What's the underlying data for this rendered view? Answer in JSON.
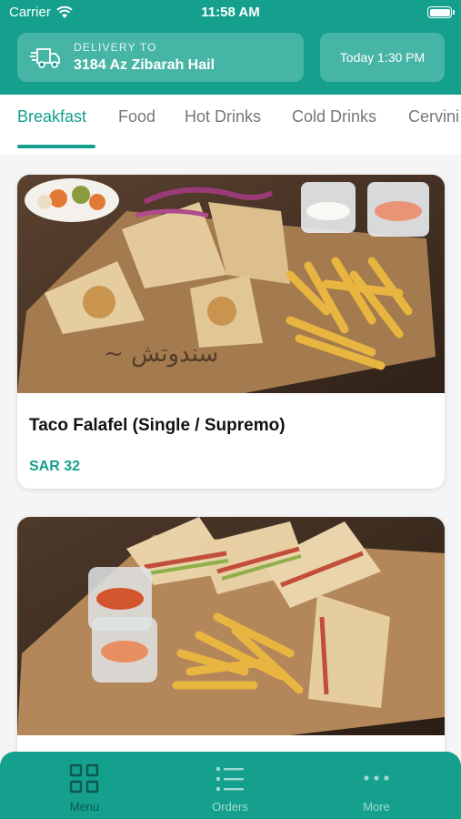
{
  "status_bar": {
    "carrier": "Carrier",
    "time": "11:58 AM"
  },
  "delivery": {
    "label": "DELIVERY TO",
    "address": "3184 Az Zibarah Hail",
    "icon": "delivery-truck-icon"
  },
  "schedule": {
    "time": "Today 1:30 PM"
  },
  "tabs": [
    {
      "label": "Breakfast",
      "active": true
    },
    {
      "label": "Food"
    },
    {
      "label": "Hot Drinks"
    },
    {
      "label": "Cold Drinks"
    },
    {
      "label": "Cervini"
    }
  ],
  "products": [
    {
      "title": "Taco Falafel (Single / Supremo)",
      "price": "SAR 32",
      "image": "taco falafel wraps with fries on wooden board"
    },
    {
      "image": "club sandwiches with fries and dipping sauces on wooden board"
    }
  ],
  "bottom_nav": [
    {
      "label": "Menu",
      "icon": "grid-icon",
      "active": true
    },
    {
      "label": "Orders",
      "icon": "list-icon"
    },
    {
      "label": "More",
      "icon": "more-dots-icon"
    }
  ],
  "colors": {
    "brand": "#14a08c",
    "background": "#f5f5f5"
  }
}
